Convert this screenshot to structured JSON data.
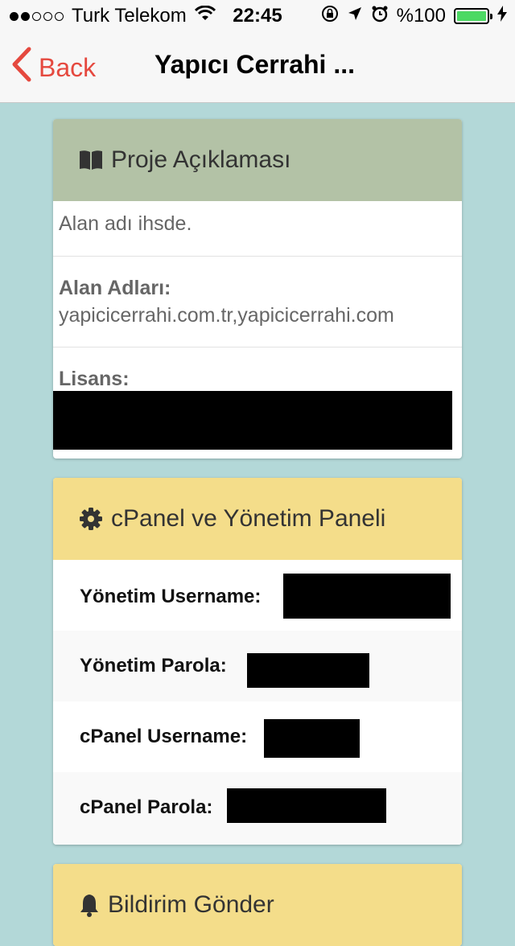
{
  "status_bar": {
    "carrier": "Turk Telekom",
    "time": "22:45",
    "battery": "%100",
    "signal_bars_filled": 2,
    "signal_bars_total": 5,
    "battery_level": 1.0
  },
  "nav": {
    "back_label": "Back",
    "title": "Yapıcı Cerrahi ..."
  },
  "project": {
    "header": "Proje Açıklaması",
    "description": "Alan adı ihsde.",
    "domains_label": "Alan Adları:",
    "domains_value": "yapicicerrahi.com.tr,yapicicerrahi.com",
    "license_label": "Lisans:"
  },
  "panel": {
    "header": "cPanel ve Yönetim Paneli",
    "rows": [
      {
        "label": "Yönetim Username:"
      },
      {
        "label": "Yönetim Parola:"
      },
      {
        "label": "cPanel Username:"
      },
      {
        "label": "cPanel Parola:"
      }
    ]
  },
  "notify": {
    "header": "Bildirim Gönder"
  },
  "colors": {
    "background": "#b3d8d8",
    "accent": "#e5493f",
    "header_green": "#b3c2a6",
    "header_yellow": "#f4dd8a",
    "battery_green": "#4cd964"
  },
  "icons": {
    "project": "book-icon",
    "panel": "gear-icon",
    "notify": "bell-icon"
  }
}
